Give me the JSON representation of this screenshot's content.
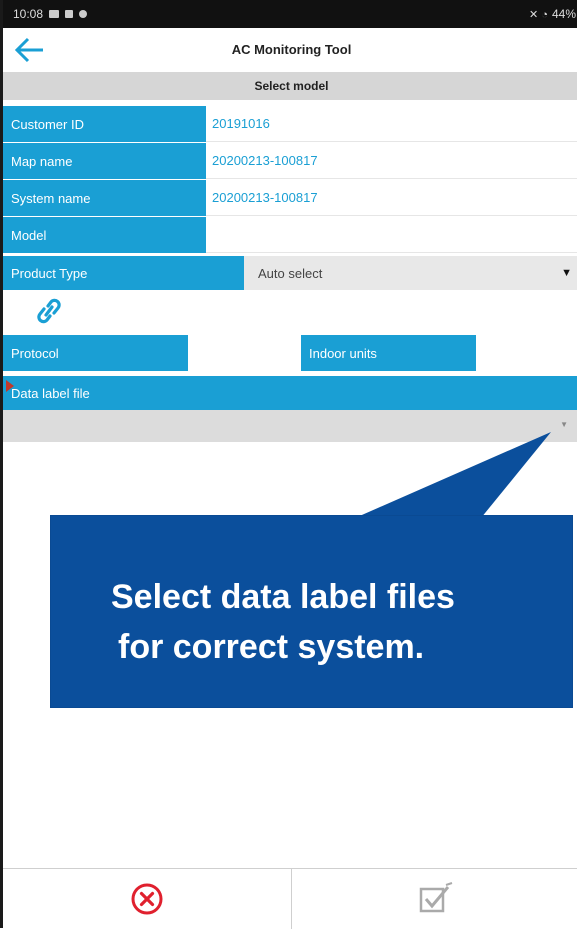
{
  "status_bar": {
    "time": "10:08",
    "battery": "44%"
  },
  "app_bar": {
    "title": "AC Monitoring Tool"
  },
  "subheader": "Select model",
  "fields": {
    "customer_id": {
      "label": "Customer ID",
      "value": "20191016"
    },
    "map_name": {
      "label": "Map name",
      "value": "20200213-100817"
    },
    "system_name": {
      "label": "System name",
      "value": "20200213-100817"
    },
    "model": {
      "label": "Model",
      "value": ""
    },
    "product_type": {
      "label": "Product Type",
      "selected": "Auto select"
    },
    "protocol": {
      "label": "Protocol",
      "value": ""
    },
    "indoor_units": {
      "label": "Indoor units",
      "value": ""
    },
    "data_label_file": {
      "label": "Data label file",
      "selected": ""
    }
  },
  "callout": {
    "line1": "Select data label files",
    "line2": "for correct system."
  },
  "icons": {
    "back": "arrow-left-icon",
    "link": "link-icon",
    "cancel": "close-circle-icon",
    "confirm": "checkbox-edit-icon"
  },
  "colors": {
    "accent": "#1a9fd4",
    "callout": "#0b4f9c",
    "cancel": "#e0202e"
  }
}
